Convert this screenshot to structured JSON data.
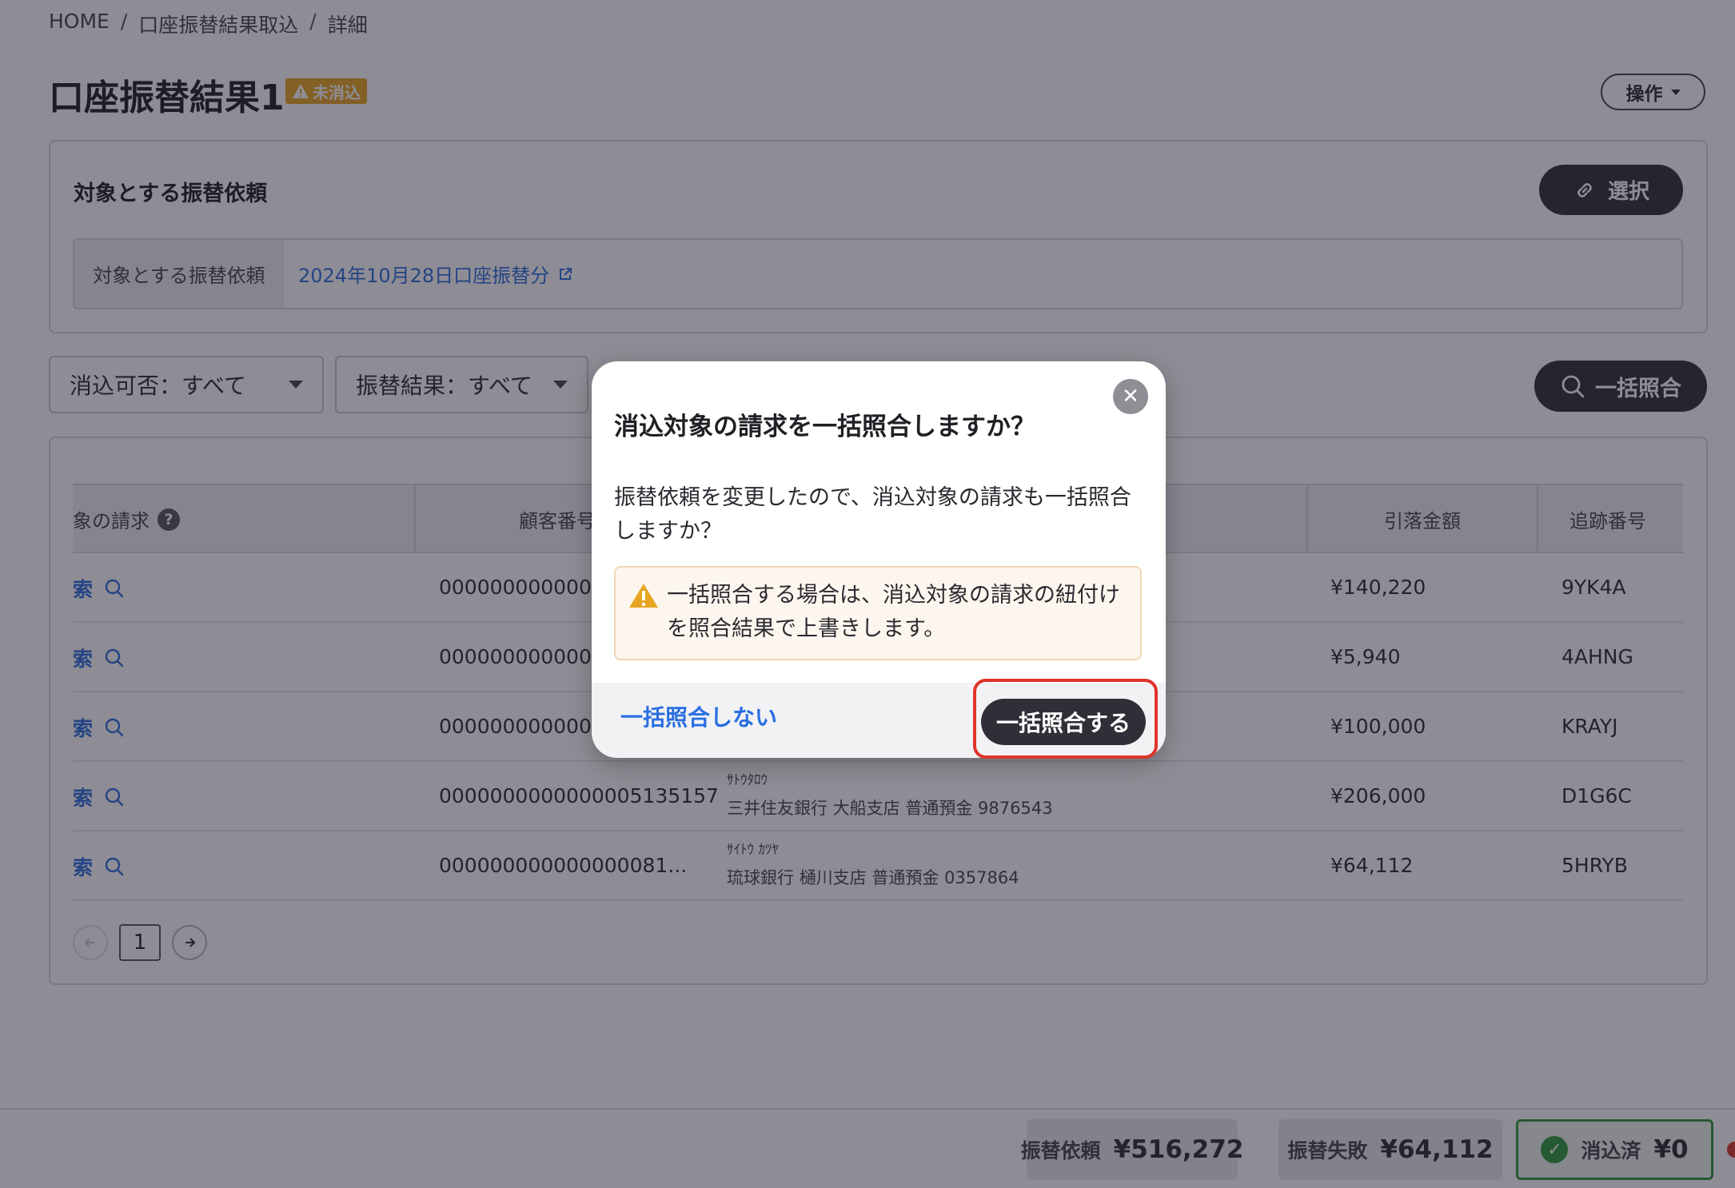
{
  "breadcrumb": [
    "HOME",
    "口座振替結果取込",
    "詳細"
  ],
  "breadcrumb_sep": "/",
  "page": {
    "title": "口座振替結果1",
    "status_badge": "未消込",
    "ops_button": "操作"
  },
  "target": {
    "heading": "対象とする振替依頼",
    "select_button": "選択",
    "row_label": "対象とする振替依頼",
    "row_value": "2024年10月28日口座振替分"
  },
  "filters": {
    "reconcile": "消込可否：すべて",
    "result": "振替結果：すべて",
    "bulk_button": "一括照合"
  },
  "table": {
    "headers": {
      "target_invoice": "象の請求",
      "customer_no": "顧客番号",
      "amount": "引落金額",
      "tracking": "追跡番号"
    },
    "search_text": "索",
    "rows": [
      {
        "customer_no": "000000000000",
        "kana": "",
        "bank": "",
        "amount": "¥140,220",
        "tracking": "9YK4A"
      },
      {
        "customer_no": "000000000000",
        "kana": "",
        "bank": "",
        "amount": "¥5,940",
        "tracking": "4AHNG"
      },
      {
        "customer_no": "000000000000",
        "kana": "",
        "bank": "",
        "amount": "¥100,000",
        "tracking": "KRAYJ"
      },
      {
        "customer_no": "0000000000000005135157",
        "kana": "ｻﾄｳﾀﾛｳ",
        "bank": "三井住友銀行 大船支店 普通預金 9876543",
        "amount": "¥206,000",
        "tracking": "D1G6C"
      },
      {
        "customer_no": "000000000000000081...",
        "kana": "ｻｲﾄｳ ｶﾂﾔ",
        "bank": "琉球銀行 樋川支店 普通預金 0357864",
        "amount": "¥64,112",
        "tracking": "5HRYB"
      }
    ]
  },
  "pager": {
    "current": "1"
  },
  "footer": {
    "request_label": "振替依頼",
    "request_value": "¥516,272",
    "failed_label": "振替失敗",
    "failed_value": "¥64,112",
    "cleared_label": "消込済",
    "cleared_value": "¥0"
  },
  "modal": {
    "title": "消込対象の請求を一括照合しますか？",
    "body": "振替依頼を変更したので、消込対象の請求も一括照合しますか？",
    "warning": "一括照合する場合は、消込対象の請求の紐付けを照合結果で上書きします。",
    "cancel_button": "一括照合しない",
    "confirm_button": "一括照合する"
  },
  "colors": {
    "accent_link": "#2a6fe0",
    "primary_button": "#2f2f37",
    "warning_badge": "#e6a623",
    "success": "#2f9a3b",
    "highlight": "#e0342a"
  }
}
